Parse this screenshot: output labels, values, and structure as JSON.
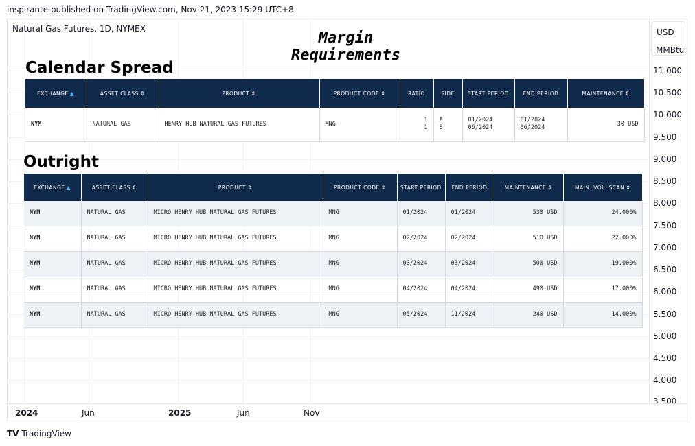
{
  "header": {
    "published": "inspirante published on TradingView.com, Nov 21, 2023 15:29 UTC+8"
  },
  "chart": {
    "symbol_legend": "Natural Gas Futures, 1D, NYMEX",
    "currency": "USD",
    "unit": "MMBtu",
    "price_labels": [
      "11.000",
      "10.500",
      "10.000",
      "9.500",
      "9.000",
      "8.500",
      "8.000",
      "7.500",
      "7.000",
      "6.500",
      "6.000",
      "5.500",
      "5.000",
      "4.500",
      "4.000",
      "3.500"
    ],
    "time_labels": [
      {
        "text": "2024",
        "bold": true
      },
      {
        "text": "Jun",
        "bold": false
      },
      {
        "text": "2025",
        "bold": true
      },
      {
        "text": "Jun",
        "bold": false
      },
      {
        "text": "Nov",
        "bold": false
      }
    ]
  },
  "overlay": {
    "title": "Margin Requirements",
    "calendar_spread": {
      "title": "Calendar Spread",
      "headers": [
        "EXCHANGE",
        "ASSET CLASS",
        "PRODUCT",
        "PRODUCT CODE",
        "RATIO",
        "SIDE",
        "START PERIOD",
        "END PERIOD",
        "MAINTENANCE"
      ],
      "row": {
        "exchange": "NYM",
        "asset_class": "NATURAL GAS",
        "product": "HENRY HUB NATURAL GAS FUTURES",
        "product_code": "MNG",
        "ratio": [
          "1",
          "1"
        ],
        "side": [
          "A",
          "B"
        ],
        "start_period": [
          "01/2024",
          "06/2024"
        ],
        "end_period": [
          "01/2024",
          "06/2024"
        ],
        "maintenance": "30 USD"
      }
    },
    "outright": {
      "title": "Outright",
      "headers": [
        "EXCHANGE",
        "ASSET CLASS",
        "PRODUCT",
        "PRODUCT CODE",
        "START PERIOD",
        "END PERIOD",
        "MAINTENANCE",
        "MAIN. VOL. SCAN"
      ],
      "rows": [
        {
          "exchange": "NYM",
          "asset_class": "NATURAL GAS",
          "product": "MICRO HENRY HUB NATURAL GAS FUTURES",
          "product_code": "MNG",
          "start_period": "01/2024",
          "end_period": "01/2024",
          "maintenance": "530 USD",
          "vol_scan": "24.000%"
        },
        {
          "exchange": "NYM",
          "asset_class": "NATURAL GAS",
          "product": "MICRO HENRY HUB NATURAL GAS FUTURES",
          "product_code": "MNG",
          "start_period": "02/2024",
          "end_period": "02/2024",
          "maintenance": "510 USD",
          "vol_scan": "22.000%"
        },
        {
          "exchange": "NYM",
          "asset_class": "NATURAL GAS",
          "product": "MICRO HENRY HUB NATURAL GAS FUTURES",
          "product_code": "MNG",
          "start_period": "03/2024",
          "end_period": "03/2024",
          "maintenance": "500 USD",
          "vol_scan": "19.000%"
        },
        {
          "exchange": "NYM",
          "asset_class": "NATURAL GAS",
          "product": "MICRO HENRY HUB NATURAL GAS FUTURES",
          "product_code": "MNG",
          "start_period": "04/2024",
          "end_period": "04/2024",
          "maintenance": "490 USD",
          "vol_scan": "17.000%"
        },
        {
          "exchange": "NYM",
          "asset_class": "NATURAL GAS",
          "product": "MICRO HENRY HUB NATURAL GAS FUTURES",
          "product_code": "MNG",
          "start_period": "05/2024",
          "end_period": "11/2024",
          "maintenance": "240 USD",
          "vol_scan": "14.000%"
        }
      ]
    }
  },
  "footer": {
    "brand": "TradingView",
    "logo_mark": "TV"
  }
}
